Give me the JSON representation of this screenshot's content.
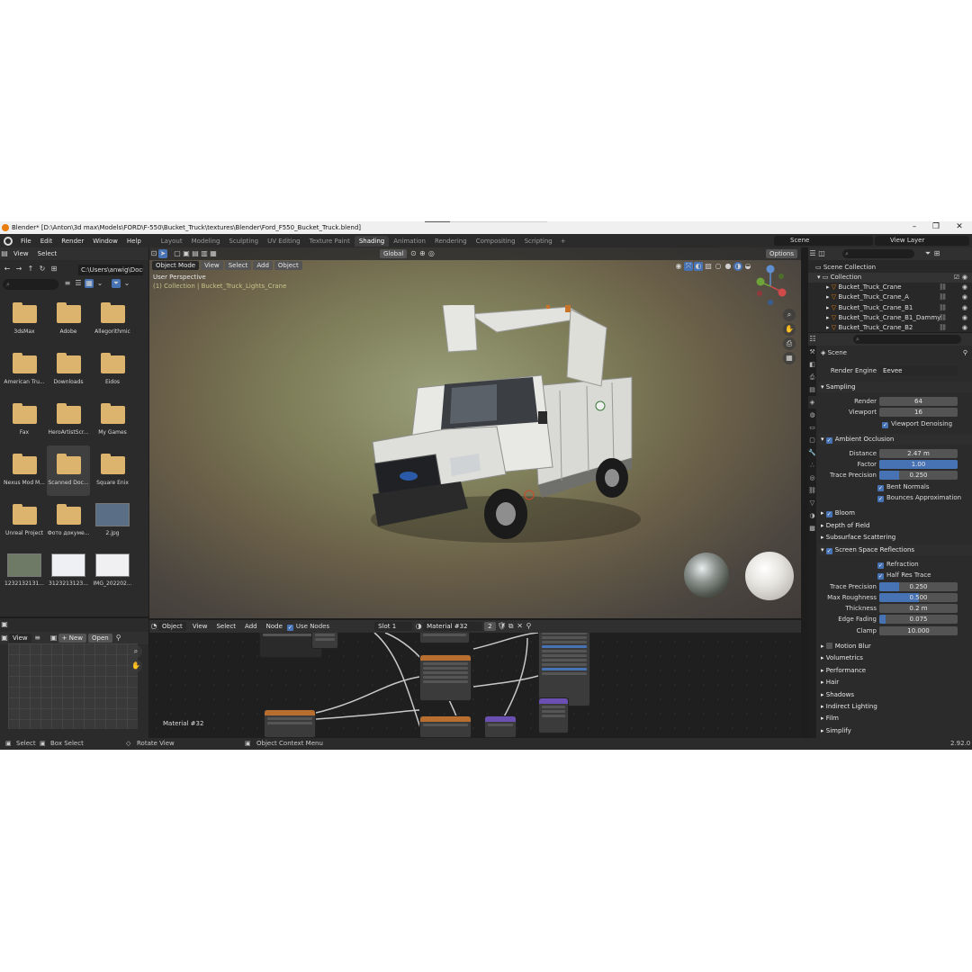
{
  "window": {
    "title": "Blender* [D:\\Anton\\3d max\\Models\\FORD\\F-550\\Bucket_Truck\\textures\\Blender\\Ford_F550_Bucket_Truck.blend]",
    "minimize": "–",
    "maximize": "❐",
    "close": "✕"
  },
  "menu": [
    "File",
    "Edit",
    "Render",
    "Window",
    "Help"
  ],
  "workspaces": [
    "Layout",
    "Modeling",
    "Sculpting",
    "UV Editing",
    "Texture Paint",
    "Shading",
    "Animation",
    "Rendering",
    "Compositing",
    "Scripting"
  ],
  "active_workspace": "Shading",
  "scene_name": "Scene",
  "view_layer": "View Layer",
  "file_browser": {
    "menu": [
      "View",
      "Select"
    ],
    "path": "C:\\Users\\anwig\\Docu...",
    "items": [
      {
        "label": "3dsMax",
        "type": "folder"
      },
      {
        "label": "Adobe",
        "type": "folder"
      },
      {
        "label": "Allegorithmic",
        "type": "folder"
      },
      {
        "label": "American Tru...",
        "type": "folder"
      },
      {
        "label": "Downloads",
        "type": "folder"
      },
      {
        "label": "Eidos",
        "type": "folder"
      },
      {
        "label": "Fax",
        "type": "folder"
      },
      {
        "label": "HeroArtistScr...",
        "type": "folder"
      },
      {
        "label": "My Games",
        "type": "folder"
      },
      {
        "label": "Nexus Mod M...",
        "type": "folder"
      },
      {
        "label": "Scanned Doc...",
        "type": "folder"
      },
      {
        "label": "Square Enix",
        "type": "folder"
      },
      {
        "label": "Unreal Project",
        "type": "folder"
      },
      {
        "label": "Фото докуме...",
        "type": "folder"
      },
      {
        "label": "2.jpg",
        "type": "image"
      },
      {
        "label": "1232132131...",
        "type": "image"
      },
      {
        "label": "3123213123...",
        "type": "image"
      },
      {
        "label": "IMG_202202...",
        "type": "image"
      }
    ]
  },
  "image_editor": {
    "view": "View",
    "new": "New",
    "open": "Open"
  },
  "viewport": {
    "mode": "Object Mode",
    "menu": [
      "View",
      "Select",
      "Add",
      "Object"
    ],
    "transform": "Global",
    "options": "Options",
    "perspective": "User Perspective",
    "collection_info": "(1) Collection | Bucket_Truck_Lights_Crane",
    "gizmo": {
      "x": "X",
      "y": "Y",
      "z": "Z"
    }
  },
  "node_editor": {
    "type": "Object",
    "menu": [
      "View",
      "Select",
      "Add",
      "Node"
    ],
    "use_nodes": "Use Nodes",
    "slot": "Slot 1",
    "material": "Material #32",
    "users": "2",
    "material_label": "Material #32"
  },
  "outliner": {
    "root": "Scene Collection",
    "collection": "Collection",
    "objects": [
      "Bucket_Truck_Crane",
      "Bucket_Truck_Crane_A",
      "Bucket_Truck_Crane_B1",
      "Bucket_Truck_Crane_B1_Dammy",
      "Bucket_Truck_Crane_B2"
    ]
  },
  "properties": {
    "context": "Scene",
    "render_engine_label": "Render Engine",
    "render_engine": "Eevee",
    "sampling": {
      "title": "Sampling",
      "render_label": "Render",
      "render": "64",
      "viewport_label": "Viewport",
      "viewport": "16",
      "denoise": "Viewport Denoising"
    },
    "ao": {
      "title": "Ambient Occlusion",
      "distance_label": "Distance",
      "distance": "2.47 m",
      "factor_label": "Factor",
      "factor": "1.00",
      "factor_fill": 1.0,
      "trace_label": "Trace Precision",
      "trace": "0.250",
      "trace_fill": 0.25,
      "bent": "Bent Normals",
      "bounces": "Bounces Approximation"
    },
    "bloom": "Bloom",
    "dof": "Depth of Field",
    "sss": "Subsurface Scattering",
    "ssr": {
      "title": "Screen Space Reflections",
      "refraction": "Refraction",
      "half_res": "Half Res Trace",
      "trace_label": "Trace Precision",
      "trace": "0.250",
      "trace_fill": 0.25,
      "rough_label": "Max Roughness",
      "rough": "0.500",
      "rough_fill": 0.5,
      "thick_label": "Thickness",
      "thick": "0.2 m",
      "edge_label": "Edge Fading",
      "edge": "0.075",
      "edge_fill": 0.075,
      "clamp_label": "Clamp",
      "clamp": "10.000"
    },
    "collapsed": [
      "Motion Blur",
      "Volumetrics",
      "Performance",
      "Hair",
      "Shadows",
      "Indirect Lighting",
      "Film",
      "Simplify"
    ]
  },
  "statusbar": {
    "select": "Select",
    "box_select": "Box Select",
    "rotate": "Rotate View",
    "context_menu": "Object Context Menu",
    "version": "2.92.0"
  },
  "colors": {
    "accent": "#4772b3",
    "active_header": "#e87d0d",
    "folder": "#dcb46e"
  }
}
